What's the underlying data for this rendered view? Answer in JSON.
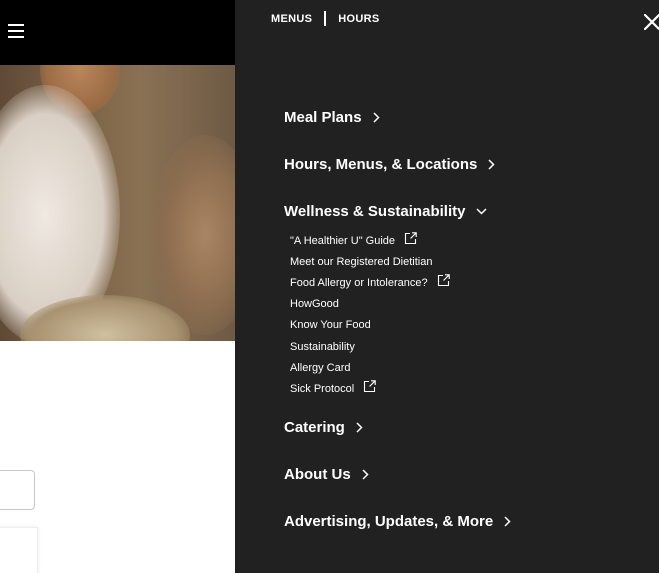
{
  "top_links": {
    "menus": "MENUS",
    "hours": "HOURS"
  },
  "nav": [
    {
      "label": "Meal Plans",
      "icon": "chevron-right-icon"
    },
    {
      "label": "Hours, Menus, & Locations",
      "icon": "chevron-right-icon"
    },
    {
      "label": "Wellness & Sustainability",
      "icon": "chevron-down-icon"
    },
    {
      "label": "Catering",
      "icon": "chevron-right-icon"
    },
    {
      "label": "About Us",
      "icon": "chevron-right-icon"
    },
    {
      "label": "Advertising, Updates, & More",
      "icon": "chevron-right-icon"
    }
  ],
  "wellness_sub": [
    {
      "label": "\"A Healthier U\" Guide",
      "external": true
    },
    {
      "label": "Meet our Registered Dietitian",
      "external": false
    },
    {
      "label": "Food Allergy or Intolerance?",
      "external": true
    },
    {
      "label": "HowGood",
      "external": false
    },
    {
      "label": "Know Your Food",
      "external": false
    },
    {
      "label": "Sustainability",
      "external": false
    },
    {
      "label": "Allergy Card",
      "external": false
    },
    {
      "label": "Sick Protocol",
      "external": true
    }
  ],
  "colors": {
    "panel_bg": "#212121",
    "header_bg": "#000000",
    "text": "#ffffff"
  }
}
